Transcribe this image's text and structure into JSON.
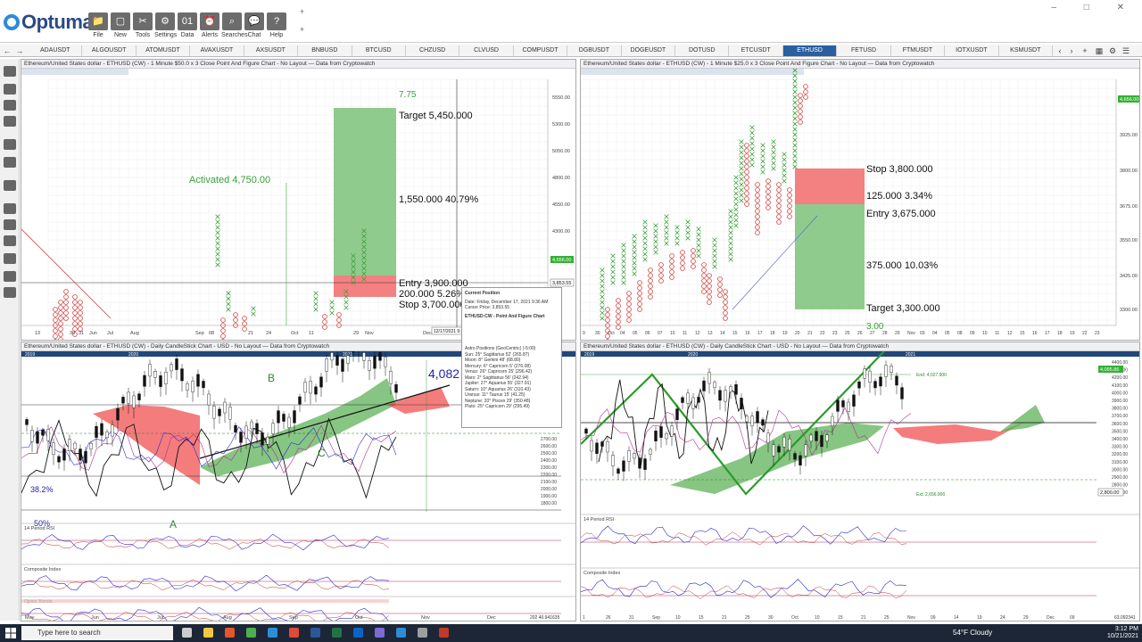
{
  "app": {
    "name": "Optuma"
  },
  "ribbon": [
    {
      "id": "file",
      "label": "File",
      "icon": "folder-icon"
    },
    {
      "id": "new",
      "label": "New",
      "icon": "new-window-icon"
    },
    {
      "id": "tools",
      "label": "Tools",
      "icon": "tools-icon"
    },
    {
      "id": "settings",
      "label": "Settings",
      "icon": "gear-icon"
    },
    {
      "id": "data",
      "label": "Data",
      "icon": "binary-data-icon"
    },
    {
      "id": "alerts",
      "label": "Alerts",
      "icon": "alarm-clock-icon"
    },
    {
      "id": "searches",
      "label": "Searches",
      "icon": "magnifier-icon"
    },
    {
      "id": "chat",
      "label": "Chat",
      "icon": "chat-bubbles-icon"
    },
    {
      "id": "help",
      "label": "Help",
      "icon": "question-mark-icon"
    }
  ],
  "tabs": [
    "ADAUSDT",
    "ALGOUSDT",
    "ATOMUSDT",
    "AVAXUSDT",
    "AXSUSDT",
    "BNBUSD",
    "BTCUSD",
    "CHZUSD",
    "CLVUSD",
    "COMPUSDT",
    "DGBUSDT",
    "DOGEUSDT",
    "DOTUSD",
    "ETCUSDT",
    "ETHUSD",
    "FETUSD",
    "FTMUSDT",
    "IOTXUSDT",
    "KSMUSDT"
  ],
  "active_tab": "ETHUSD",
  "panels": {
    "tl": {
      "title": "Ethereum/United States dollar - ETHUSD (CW) - 1 Minute $50.0 x 3 Close Point And Figure Chart - No Layout — Data from Cryptowatch",
      "labels": {
        "activated": "Activated 4,750.00",
        "target": "Target  5,450.000",
        "move": "1,550.000  40.79%",
        "entry": "Entry  3,900.000",
        "risk": "200.000  5.26%",
        "stop": "Stop  3,700.000",
        "ratio": "7.75",
        "price_badge": "4,656.00",
        "cursor_price": "3,853.55",
        "cursor_date": "12/17/2021 9:36"
      },
      "y_ticks": [
        "5550.00",
        "5300.00",
        "5050.00",
        "4800.00",
        "4550.00",
        "4300.00",
        "4050.00",
        "3800.00"
      ],
      "x_ticks": [
        "13",
        "30",
        "31",
        "Jun",
        "Jul",
        "Aug",
        "Sep",
        "08",
        "21",
        "24",
        "Oct",
        "11",
        "29",
        "Nov",
        "Dec"
      ]
    },
    "tr": {
      "title": "Ethereum/United States dollar - ETHUSD (CW) - 1 Minute $25.0 x 3 Close Point And Figure Chart - No Layout — Data from Cryptowatch",
      "labels": {
        "stop": "Stop  3,800.000",
        "risk": "125.000  3.34%",
        "entry": "Entry  3,675.000",
        "move": "375.000  10.03%",
        "target": "Target  3,300.000",
        "ratio": "3.00",
        "price_badge": "4,656.00"
      },
      "y_ticks": [
        "3925.00",
        "3800.00",
        "3675.00",
        "3550.00",
        "3425.00",
        "3300.00"
      ],
      "x_ticks": [
        "9",
        "30",
        "Oct",
        "04",
        "05",
        "06",
        "07",
        "10",
        "11",
        "12",
        "13",
        "14",
        "15",
        "16",
        "17",
        "18",
        "19",
        "20",
        "21",
        "22",
        "23",
        "25",
        "26",
        "27",
        "28",
        "29",
        "Nov",
        "03",
        "04",
        "05",
        "08",
        "09",
        "10",
        "11",
        "12",
        "15",
        "16",
        "17",
        "18",
        "19",
        "22",
        "23"
      ]
    },
    "bl": {
      "title": "Ethereum/United States dollar - ETHUSD (CW) - Daily CandleStick Chart - USD - No Layout — Data from Cryptowatch",
      "years": [
        "2019",
        "2020",
        "2021"
      ],
      "labels": {
        "b": "B",
        "c": "C",
        "a": "A",
        "level": "4,082",
        "pct1": "38.2%",
        "pct2": "50%"
      },
      "subcharts": [
        "14 Period RSI",
        "Composite Index",
        "Optex Bands"
      ],
      "x_ticks": [
        "May",
        "Jun",
        "Jul",
        "Aug",
        "Sep",
        "Oct",
        "Nov",
        "Dec"
      ],
      "y_ticks": [
        "2700.00",
        "2600.00",
        "2500.00",
        "2400.00",
        "2300.00",
        "2200.00",
        "2100.00",
        "2000.00",
        "1900.00",
        "1800.00"
      ],
      "footer": "202 40.941635"
    },
    "popup": {
      "title": "Current Position",
      "date": "Date: Friday, December 17, 2021 9:36 AM",
      "cursor": "Cursor Price: 3,853.55",
      "symbol": "ETHUSD:CW - Point And Figure Chart",
      "astro_title": "Astro Positions (GeoCentric) (-5:00)",
      "astro": [
        "Sun: 25° Sagittarius 52' (265.87)",
        "Moon: 8° Gemini 48' (68.80)",
        "Mercury: 6° Capricorn 5' (276.08)",
        "Venus: 26° Capricorn 25' (296.42)",
        "Mars: 2° Sagittarius 56' (242.94)",
        "Jupiter: 27° Aquarius 55' (327.91)",
        "Saturn: 10° Aquarius 26' (310.43)",
        "Uranus: 11° Taurus 15' (41.25)",
        "Neptune: 20° Pisces 29' (350.48)",
        "Pluto: 25° Capricorn 29' (295.49)"
      ]
    },
    "br": {
      "title": "Ethereum/United States dollar - ETHUSD (CW) - Daily CandleStick Chart - USD - No Layout — Data from Cryptowatch",
      "years": [
        "2019",
        "2020",
        "2021"
      ],
      "labels": {
        "end": "End: 4,027.900",
        "ext": "Ext: 2,656.900",
        "price_badge": "4,095.86",
        "level_badge": "2,800.00"
      },
      "subcharts": [
        "14 Period RSI",
        "Composite Index"
      ],
      "y_ticks": [
        "4400.00",
        "4300.00",
        "4200.00",
        "4100.00",
        "4000.00",
        "3900.00",
        "3800.00",
        "3700.00",
        "3600.00",
        "3500.00",
        "3400.00",
        "3300.00",
        "3200.00",
        "3100.00",
        "3000.00",
        "2900.00",
        "2800.00",
        "2700.00"
      ],
      "x_ticks": [
        "1",
        "26",
        "31",
        "Sep",
        "10",
        "15",
        "21",
        "25",
        "30",
        "Oct",
        "10",
        "15",
        "21",
        "25",
        "Nov",
        "09",
        "14",
        "19",
        "24",
        "29",
        "Dec",
        "09"
      ],
      "footer": "63.092341"
    }
  },
  "taskbar": {
    "search_placeholder": "Type here to search",
    "weather": "54°F  Cloudy",
    "time": "3:12 PM",
    "date": "10/21/2021"
  },
  "colors": {
    "accent": "#2a5fa0",
    "green_zone": "#7cc27a",
    "red_zone": "#f26b6b",
    "cloud_green": "#5fb25a",
    "cloud_red": "#f05050",
    "x_mark": "#3aa03a",
    "o_mark": "#d04040"
  }
}
